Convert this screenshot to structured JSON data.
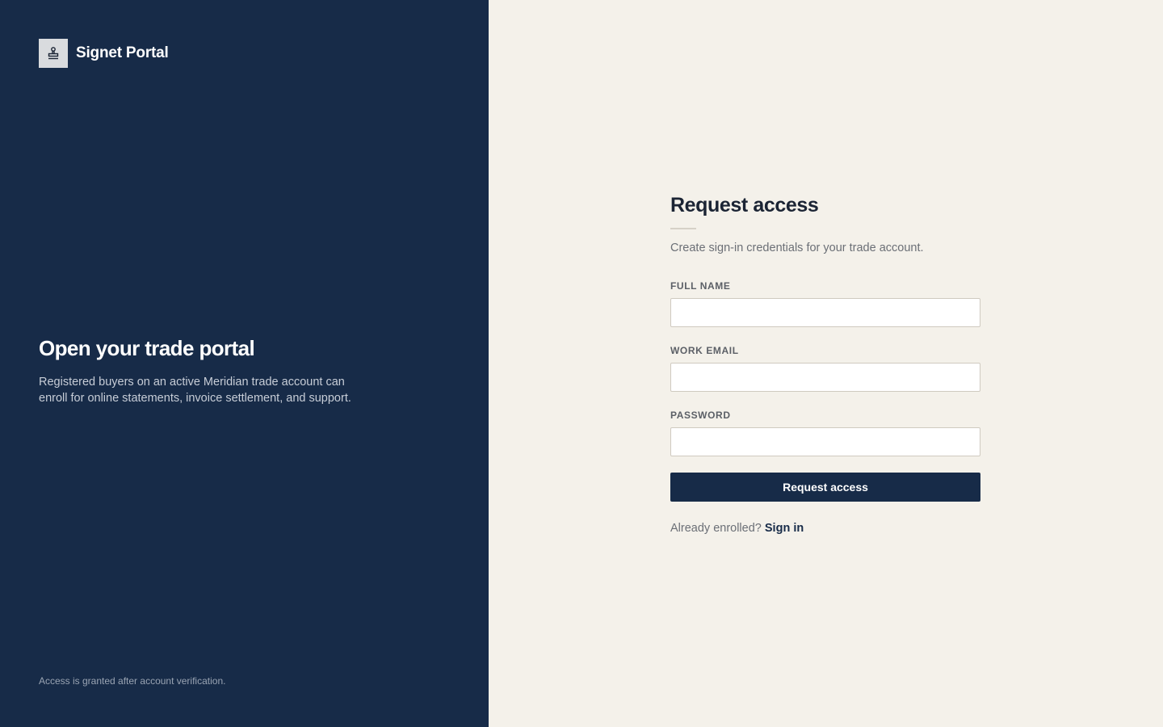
{
  "brand": {
    "name": "Signet Portal",
    "icon": "stamp-icon"
  },
  "hero": {
    "title": "Open your trade portal",
    "description": "Registered buyers on an active Meridian trade account can enroll for online statements, invoice settlement, and support."
  },
  "footnote": "Access is granted after account verification.",
  "form": {
    "title": "Request access",
    "subtitle": "Create sign-in credentials for your trade account.",
    "fields": [
      {
        "label": "FULL NAME",
        "value": "",
        "placeholder": ""
      },
      {
        "label": "WORK EMAIL",
        "value": "",
        "placeholder": ""
      },
      {
        "label": "PASSWORD",
        "value": "",
        "placeholder": ""
      }
    ],
    "submit_label": "Request access",
    "signin_prompt": "Already enrolled?",
    "signin_link": "Sign in"
  },
  "colors": {
    "panel": "#172b48",
    "background": "#f4f1ea",
    "accent": "#172b48"
  }
}
